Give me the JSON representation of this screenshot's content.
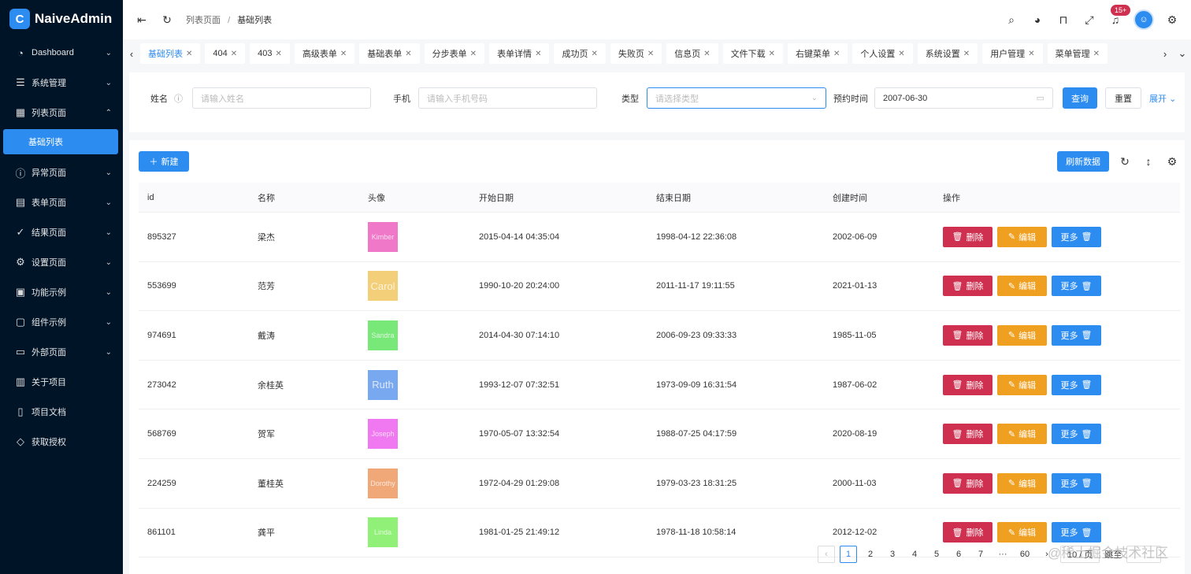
{
  "app": {
    "name": "NaiveAdmin",
    "logo_char": "C"
  },
  "sidebar": {
    "items": [
      {
        "label": "Dashboard",
        "icon": "dashboard-icon",
        "glyph": "◔",
        "chevron": "⌄"
      },
      {
        "label": "系统管理",
        "icon": "sliders-icon",
        "glyph": "☰",
        "chevron": "⌄"
      },
      {
        "label": "列表页面",
        "icon": "table-icon",
        "glyph": "▦",
        "chevron": "⌃"
      },
      {
        "label": "异常页面",
        "icon": "exclamation-circle-icon",
        "glyph": "ⓘ",
        "chevron": "⌄"
      },
      {
        "label": "表单页面",
        "icon": "form-icon",
        "glyph": "▤",
        "chevron": "⌄"
      },
      {
        "label": "结果页面",
        "icon": "check-circle-icon",
        "glyph": "✓",
        "chevron": "⌄"
      },
      {
        "label": "设置页面",
        "icon": "settings-icon",
        "glyph": "⚙",
        "chevron": "⌄"
      },
      {
        "label": "功能示例",
        "icon": "function-icon",
        "glyph": "▣",
        "chevron": "⌄"
      },
      {
        "label": "组件示例",
        "icon": "component-icon",
        "glyph": "▢",
        "chevron": "⌄"
      },
      {
        "label": "外部页面",
        "icon": "desktop-icon",
        "glyph": "▭",
        "chevron": "⌄"
      },
      {
        "label": "关于项目",
        "icon": "project-icon",
        "glyph": "▥",
        "chevron": ""
      },
      {
        "label": "项目文档",
        "icon": "document-icon",
        "glyph": "▯",
        "chevron": ""
      },
      {
        "label": "获取授权",
        "icon": "diamond-icon",
        "glyph": "◇",
        "chevron": ""
      }
    ],
    "active_sub": "基础列表"
  },
  "header": {
    "breadcrumb": [
      "列表页面",
      "基础列表"
    ],
    "breadcrumb_sep": "/",
    "notification_count": "15+",
    "avatar_char": "☺"
  },
  "tabs": [
    "基础列表",
    "404",
    "403",
    "高级表单",
    "基础表单",
    "分步表单",
    "表单详情",
    "成功页",
    "失败页",
    "信息页",
    "文件下载",
    "右键菜单",
    "个人设置",
    "系统设置",
    "用户管理",
    "菜单管理"
  ],
  "search": {
    "name_label": "姓名",
    "name_placeholder": "请输入姓名",
    "phone_label": "手机",
    "phone_placeholder": "请输入手机号码",
    "type_label": "类型",
    "type_placeholder": "请选择类型",
    "date_label": "预约时间",
    "date_value": "2007-06-30",
    "query_label": "查询",
    "reset_label": "重置",
    "expand_label": "展开"
  },
  "toolbar": {
    "new_label": "新建",
    "refresh_label": "刷新数据"
  },
  "table": {
    "columns": [
      "id",
      "名称",
      "头像",
      "开始日期",
      "结束日期",
      "创建时间",
      "操作"
    ],
    "action_delete": "删除",
    "action_edit": "编辑",
    "action_more": "更多",
    "rows": [
      {
        "id": "895327",
        "name": "梁杰",
        "avatar_text": "Kimber",
        "avatar_color": "#f078c8",
        "start": "2015-04-14 04:35:04",
        "end": "1998-04-12 22:36:08",
        "created": "2002-06-09"
      },
      {
        "id": "553699",
        "name": "范芳",
        "avatar_text": "Carol",
        "avatar_color": "#f2cf78",
        "start": "1990-10-20 20:24:00",
        "end": "2011-11-17 19:11:55",
        "created": "2021-01-13"
      },
      {
        "id": "974691",
        "name": "戴涛",
        "avatar_text": "Sandra",
        "avatar_color": "#78e878",
        "start": "2014-04-30 07:14:10",
        "end": "2006-09-23 09:33:33",
        "created": "1985-11-05"
      },
      {
        "id": "273042",
        "name": "余桂英",
        "avatar_text": "Ruth",
        "avatar_color": "#78a8f0",
        "start": "1993-12-07 07:32:51",
        "end": "1973-09-09 16:31:54",
        "created": "1987-06-02"
      },
      {
        "id": "568769",
        "name": "贺军",
        "avatar_text": "Joseph",
        "avatar_color": "#f078f0",
        "start": "1970-05-07 13:32:54",
        "end": "1988-07-25 04:17:59",
        "created": "2020-08-19"
      },
      {
        "id": "224259",
        "name": "董桂英",
        "avatar_text": "Dorothy",
        "avatar_color": "#f0a878",
        "start": "1972-04-29 01:29:08",
        "end": "1979-03-23 18:31:25",
        "created": "2000-11-03"
      },
      {
        "id": "861101",
        "name": "龚平",
        "avatar_text": "Linda",
        "avatar_color": "#90f078",
        "start": "1981-01-25 21:49:12",
        "end": "1978-11-18 10:58:14",
        "created": "2012-12-02"
      }
    ]
  },
  "pagination": {
    "pages": [
      "1",
      "2",
      "3",
      "4",
      "5",
      "6",
      "7",
      "···",
      "60"
    ],
    "current": "1",
    "page_size": "10 / 页",
    "goto_label": "跳至"
  },
  "watermark": "@稀土掘金技术社区"
}
